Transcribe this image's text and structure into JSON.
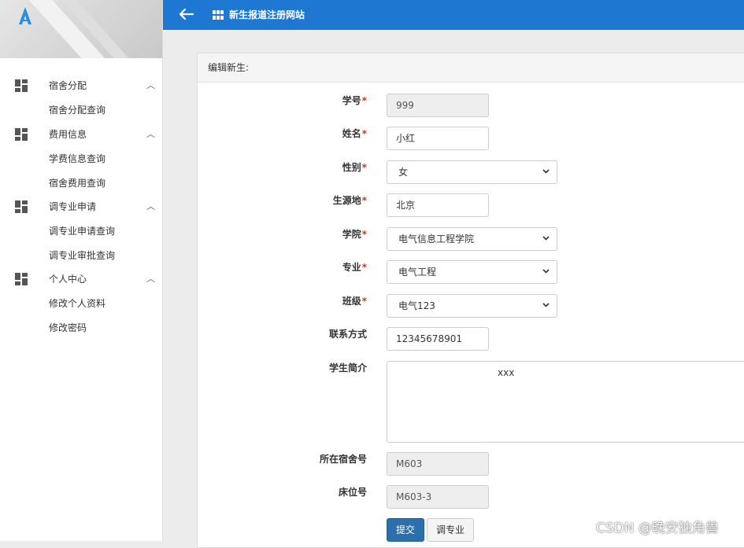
{
  "header": {
    "title": "新生报道注册网站"
  },
  "sidebar": {
    "groups": [
      {
        "label": "宿舍分配",
        "items": [
          "宿舍分配查询"
        ]
      },
      {
        "label": "费用信息",
        "items": [
          "学费信息查询",
          "宿舍费用查询"
        ]
      },
      {
        "label": "调专业申请",
        "items": [
          "调专业申请查询",
          "调专业审批查询"
        ]
      },
      {
        "label": "个人中心",
        "items": [
          "修改个人资料",
          "修改密码"
        ]
      }
    ]
  },
  "panel": {
    "title": "编辑新生:"
  },
  "form": {
    "student_id": {
      "label": "学号",
      "required": "*",
      "value": "999"
    },
    "name": {
      "label": "姓名",
      "required": "*",
      "value": "小红"
    },
    "gender": {
      "label": "性别",
      "required": "*",
      "value": "女"
    },
    "origin": {
      "label": "生源地",
      "required": "*",
      "value": "北京"
    },
    "college": {
      "label": "学院",
      "required": "*",
      "value": "电气信息工程学院"
    },
    "major": {
      "label": "专业",
      "required": "*",
      "value": "电气工程"
    },
    "class": {
      "label": "班级",
      "required": "*",
      "value": "电气123"
    },
    "contact": {
      "label": "联系方式",
      "value": "12345678901"
    },
    "intro": {
      "label": "学生简介",
      "value": "xxx"
    },
    "dorm": {
      "label": "所在宿舍号",
      "value": "M603"
    },
    "bed": {
      "label": "床位号",
      "value": "M603-3"
    }
  },
  "buttons": {
    "submit": "提交",
    "change_major": "调专业"
  },
  "watermark": "CSDN @晚安独角兽",
  "colors": {
    "topbar": "#1e78d2",
    "required": "#c0392b",
    "primary_button": "#2c6fad"
  }
}
